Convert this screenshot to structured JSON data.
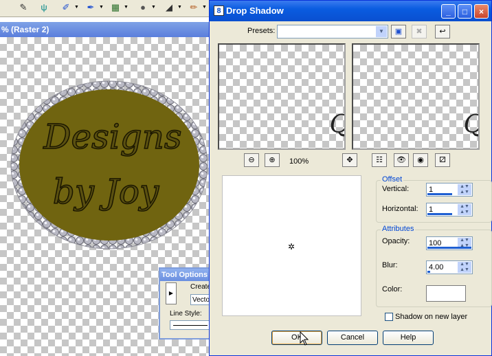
{
  "toolbar": {
    "icons": [
      "pen-tool-icon",
      "picture-tube-icon",
      "brush-icon",
      "clone-icon",
      "color-replacer-icon",
      "eraser-icon",
      "pencil-icon"
    ]
  },
  "canvas": {
    "title": "% (Raster 2)",
    "logo_line1": "Designs",
    "logo_line2": "by Joy",
    "logo_color": "#706410"
  },
  "tool_options": {
    "title": "Tool Options",
    "create_label": "Create",
    "create_value": "Vecto",
    "line_style_label": "Line Style:"
  },
  "dialog": {
    "title": "Drop Shadow",
    "app_icon": "8",
    "presets_label": "Presets:",
    "presets_value": "",
    "zoom_label": "100%",
    "preview_glyph": "Q",
    "offset": {
      "title": "Offset",
      "vertical_label": "Vertical:",
      "vertical_value": "1",
      "horizontal_label": "Horizontal:",
      "horizontal_value": "1"
    },
    "attributes": {
      "title": "Attributes",
      "opacity_label": "Opacity:",
      "opacity_value": "100",
      "blur_label": "Blur:",
      "blur_value": "4.00",
      "color_label": "Color:",
      "color_value": "#ffffff"
    },
    "shadow_layer_label": "Shadow on new layer",
    "shadow_layer_checked": false,
    "ok_label": "OK",
    "cancel_label": "Cancel",
    "help_label": "Help"
  }
}
